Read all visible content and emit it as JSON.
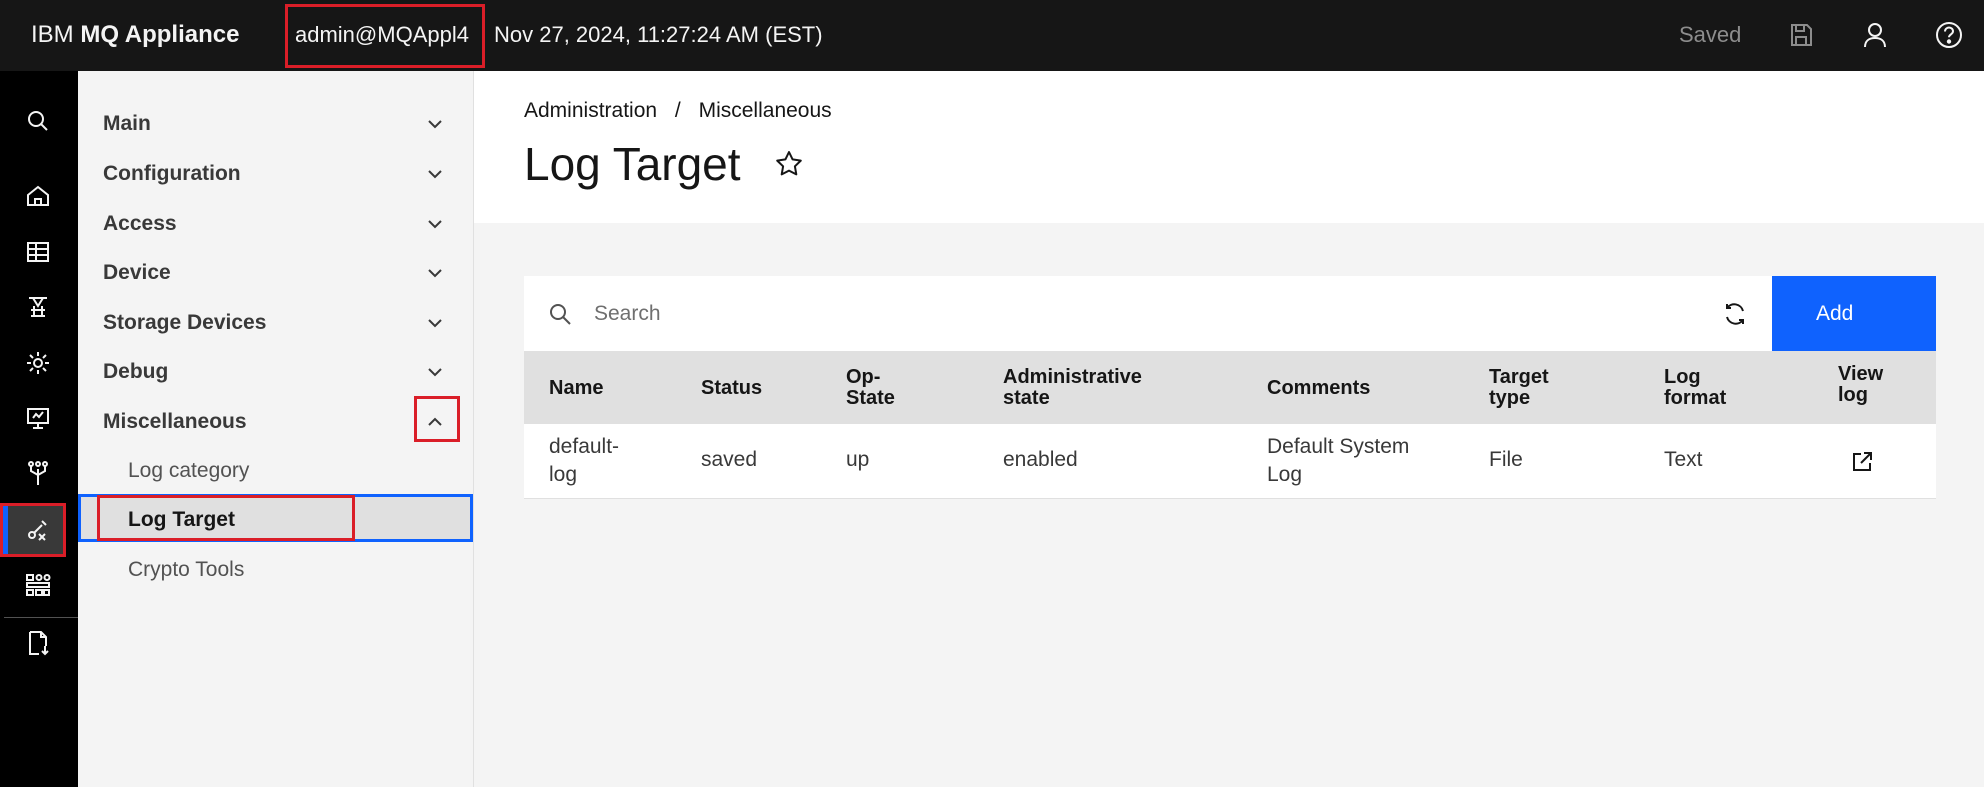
{
  "header": {
    "brand_prefix": "IBM",
    "brand_name": "MQ Appliance",
    "user": "admin@MQAppl4",
    "datetime": "Nov 27, 2024, 11:27:24 AM (EST)",
    "saved_status": "Saved",
    "icons": [
      "save-icon",
      "user-icon",
      "help-icon"
    ]
  },
  "rail": {
    "icons": [
      "search-icon",
      "home-icon",
      "table-icon",
      "monitor-queue-icon",
      "settings-icon",
      "deploy-icon",
      "network-icon",
      "tools-icon",
      "grid-icon",
      "file-download-icon"
    ],
    "active": "tools-icon"
  },
  "sidenav": {
    "groups": [
      {
        "label": "Main"
      },
      {
        "label": "Configuration"
      },
      {
        "label": "Access"
      },
      {
        "label": "Device"
      },
      {
        "label": "Storage Devices"
      },
      {
        "label": "Debug"
      },
      {
        "label": "Miscellaneous"
      }
    ],
    "sub_items": [
      {
        "label": "Log category"
      },
      {
        "label": "Log Target"
      },
      {
        "label": "Crypto Tools"
      }
    ],
    "selected": "Log Target"
  },
  "breadcrumb": {
    "items": [
      "Administration",
      "Miscellaneous"
    ],
    "separator": "/"
  },
  "page": {
    "title": "Log Target"
  },
  "toolbar": {
    "search_placeholder": "Search",
    "add_label": "Add"
  },
  "table": {
    "headers": [
      "Name",
      "Status",
      "Op-State",
      "Administrative state",
      "Comments",
      "Target type",
      "Log format",
      "View log"
    ],
    "rows": [
      {
        "name": "default-log",
        "status": "saved",
        "op_state": "up",
        "admin_state": "enabled",
        "comments": "Default System Log",
        "target_type": "File",
        "log_format": "Text"
      }
    ]
  },
  "colors": {
    "header_bg": "#161616",
    "rail_bg": "#000000",
    "accent": "#0f62fe",
    "highlight": "#da1e28",
    "content_bg": "#f4f4f4"
  }
}
